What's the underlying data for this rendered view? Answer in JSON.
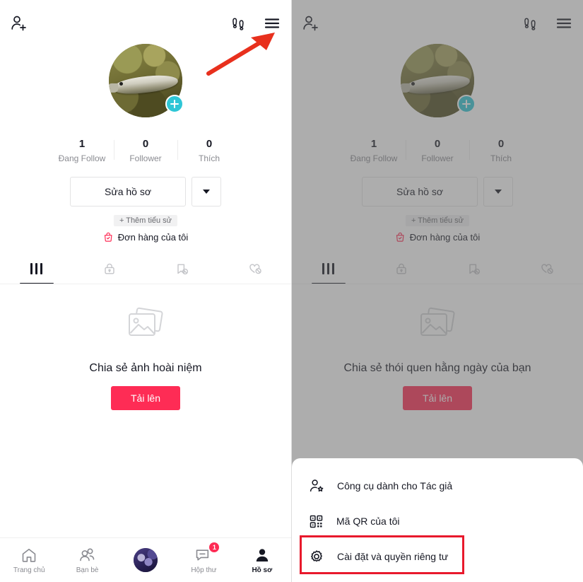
{
  "app": {
    "platform": "TikTok Lite profile (Vietnamese)"
  },
  "colors": {
    "accent_red": "#fe2c55",
    "highlight_red": "#e8192c",
    "badge_cyan": "#2ec6d6",
    "text_primary": "#161823",
    "text_muted": "#8a8b91",
    "dim_overlay": "#616161"
  },
  "header": {
    "add_friend_icon": "person-add-icon",
    "footprints_icon": "footprints-icon",
    "menu_icon": "hamburger-menu-icon"
  },
  "annotation": {
    "arrow": "red-arrow-pointing-to-menu"
  },
  "profile": {
    "avatar_alt": "fish-photo-avatar",
    "add_badge_icon": "plus-icon",
    "stats": [
      {
        "num": "1",
        "label": "Đang Follow"
      },
      {
        "num": "0",
        "label": "Follower"
      },
      {
        "num": "0",
        "label": "Thích"
      }
    ],
    "edit_profile_label": "Sửa hồ sơ",
    "dropdown_icon": "chevron-down-icon",
    "add_bio_label": "+ Thêm tiểu sử",
    "orders_label": "Đơn hàng của tôi",
    "orders_icon": "shopping-bag-icon"
  },
  "tabs": [
    {
      "name": "posts",
      "icon": "grid-icon",
      "active": true
    },
    {
      "name": "private",
      "icon": "lock-icon",
      "active": false
    },
    {
      "name": "saved",
      "icon": "bookmark-hidden-icon",
      "active": false
    },
    {
      "name": "liked",
      "icon": "heart-hidden-icon",
      "active": false
    }
  ],
  "empty_state_left": {
    "icon": "photos-stack-icon",
    "text": "Chia sẻ ảnh hoài niệm",
    "upload_label": "Tải lên"
  },
  "empty_state_right": {
    "icon": "photos-stack-icon",
    "text": "Chia sẻ thói quen hằng ngày của bạn",
    "upload_label": "Tải lên"
  },
  "bottom_nav": [
    {
      "label": "Trang chủ",
      "icon": "home-icon",
      "active": false,
      "badge": ""
    },
    {
      "label": "Bạn bè",
      "icon": "friends-icon",
      "active": false,
      "badge": ""
    },
    {
      "label": "",
      "icon": "center-avatar-icon",
      "active": false,
      "badge": ""
    },
    {
      "label": "Hộp thư",
      "icon": "inbox-message-icon",
      "active": false,
      "badge": "1"
    },
    {
      "label": "Hồ sơ",
      "icon": "profile-person-icon",
      "active": true,
      "badge": ""
    }
  ],
  "sheet": {
    "items": [
      {
        "label": "Công cụ dành cho Tác giả",
        "icon": "creator-tools-icon"
      },
      {
        "label": "Mã QR của tôi",
        "icon": "qr-code-icon"
      },
      {
        "label": "Cài đặt và quyền riêng tư",
        "icon": "settings-gear-icon"
      }
    ],
    "highlighted_index": 2
  }
}
